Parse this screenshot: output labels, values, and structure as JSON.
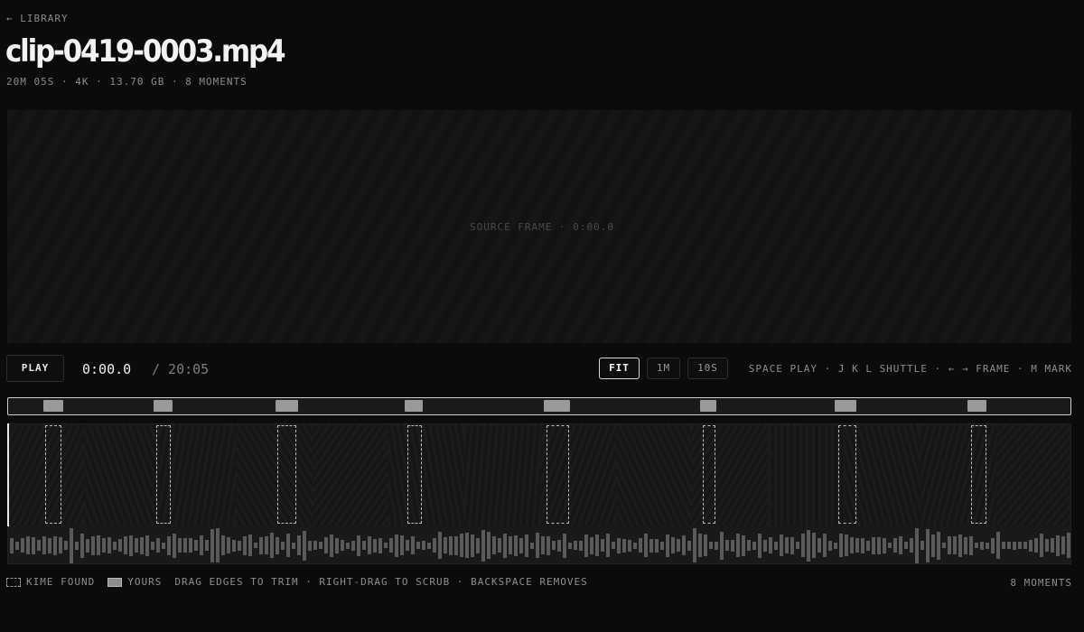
{
  "nav": {
    "back_label": "← LIBRARY"
  },
  "clip": {
    "title": "clip-0419-0003.mp4",
    "meta": "20M 05S · 4K · 13.70 GB · 8 MOMENTS"
  },
  "preview": {
    "label": "SOURCE FRAME · 0:00.0"
  },
  "transport": {
    "play_label": "PLAY",
    "current_time": "0:00.0",
    "duration": "/ 20:05",
    "zoom_options": [
      "FIT",
      "1M",
      "10S"
    ],
    "zoom_selected": "FIT",
    "shortcuts": "SPACE PLAY · J K L SHUTTLE · ← → FRAME · M MARK"
  },
  "timeline": {
    "playhead_fraction": 0.0,
    "moments": [
      {
        "start": 0.035,
        "end": 0.05
      },
      {
        "start": 0.139,
        "end": 0.153
      },
      {
        "start": 0.253,
        "end": 0.271
      },
      {
        "start": 0.375,
        "end": 0.389
      },
      {
        "start": 0.506,
        "end": 0.527
      },
      {
        "start": 0.653,
        "end": 0.665
      },
      {
        "start": 0.78,
        "end": 0.797
      },
      {
        "start": 0.905,
        "end": 0.919
      }
    ]
  },
  "legend": {
    "kime_found": "KIME FOUND",
    "yours": "YOURS",
    "help": "DRAG EDGES TO TRIM · RIGHT-DRAG TO SCRUB · BACKSPACE REMOVES",
    "count": "8 MOMENTS"
  },
  "colors": {
    "background": "#0b0b0b",
    "accent": "#e8e8e8",
    "moment_fill": "#9a9a9a"
  }
}
